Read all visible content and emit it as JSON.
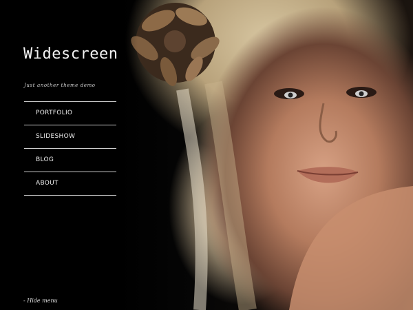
{
  "site": {
    "title": "Widescreen",
    "tagline": "Just another theme demo"
  },
  "nav": {
    "items": [
      {
        "label": "PORTFOLIO"
      },
      {
        "label": "SLIDESHOW"
      },
      {
        "label": "BLOG"
      },
      {
        "label": "ABOUT"
      }
    ]
  },
  "footer": {
    "hide_menu_label": "- Hide menu"
  },
  "colors": {
    "background": "#000000",
    "text": "#f0f0f0",
    "divider": "#cfcfcf"
  }
}
